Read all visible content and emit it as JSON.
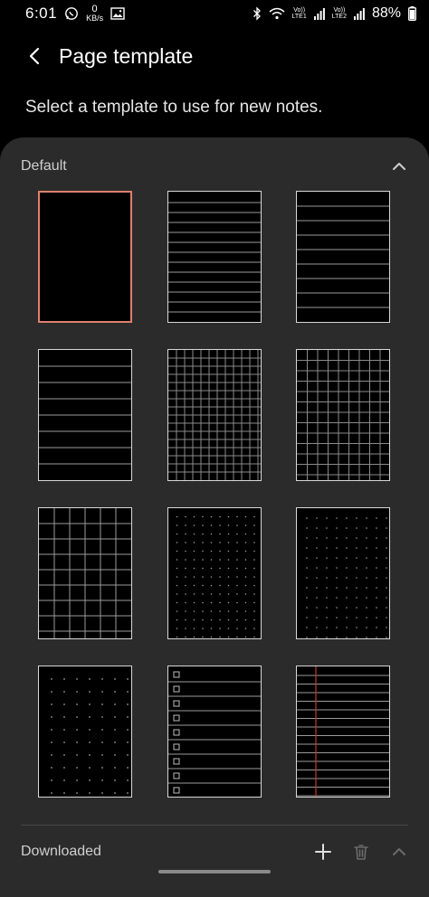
{
  "status_bar": {
    "time": "6:01",
    "kbs_value": "0",
    "kbs_unit": "KB/s",
    "net1_top": "Vo))",
    "net1_bottom": "LTE1",
    "net2_top": "Vo))",
    "net2_bottom": "LTE2",
    "battery": "88%"
  },
  "header": {
    "back_icon": "back-arrow-icon",
    "title": "Page template"
  },
  "subtitle": "Select a template to use for new notes.",
  "default_section": {
    "title": "Default",
    "collapse_icon": "chevron-up-icon",
    "templates": [
      {
        "kind": "blank",
        "selected": true
      },
      {
        "kind": "lines-narrow",
        "selected": false
      },
      {
        "kind": "lines-medium",
        "selected": false
      },
      {
        "kind": "lines-wide",
        "selected": false
      },
      {
        "kind": "grid-fine",
        "selected": false
      },
      {
        "kind": "grid-medium",
        "selected": false
      },
      {
        "kind": "grid-large",
        "selected": false
      },
      {
        "kind": "dots-fine",
        "selected": false
      },
      {
        "kind": "dots-medium",
        "selected": false
      },
      {
        "kind": "dots-large",
        "selected": false
      },
      {
        "kind": "checklist",
        "selected": false
      },
      {
        "kind": "ruled-margin",
        "selected": false
      }
    ]
  },
  "downloaded_section": {
    "title": "Downloaded",
    "add_icon": "plus-icon",
    "delete_icon": "trash-icon",
    "collapse_icon": "chevron-up-icon"
  },
  "colors": {
    "selected_border": "#e0806b",
    "margin_line": "#c0392b",
    "panel_bg": "#2b2b2b"
  }
}
